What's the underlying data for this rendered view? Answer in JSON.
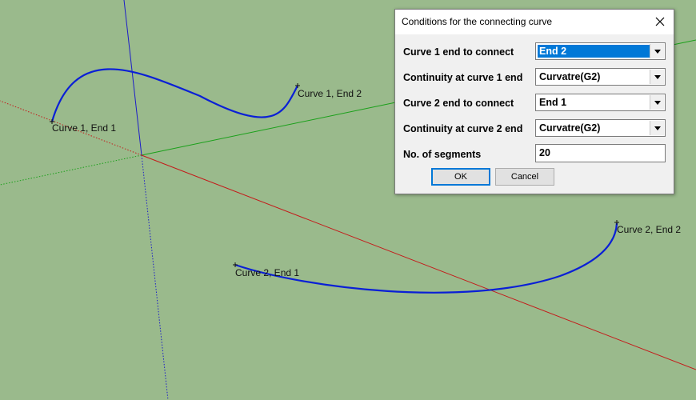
{
  "viewport": {
    "labels": {
      "c1e1": "Curve 1, End 1",
      "c1e2": "Curve 1, End 2",
      "c2e1": "Curve 2, End 1",
      "c2e2": "Curve 2, End 2"
    },
    "colors": {
      "background": "#9aba8c",
      "curve": "#0a1fd6",
      "x_axis": "#c41a1a",
      "y_axis": "#1aa01a",
      "z_axis": "#1c1cc8"
    }
  },
  "dialog": {
    "title": "Conditions for the connecting curve",
    "close_icon": "close-icon",
    "rows": [
      {
        "label": "Curve 1 end to connect",
        "value": "End 2"
      },
      {
        "label": "Continuity at curve 1 end",
        "value": "Curvatre(G2)"
      },
      {
        "label": "Curve 2 end to connect",
        "value": "End 1"
      },
      {
        "label": "Continuity at curve 2 end",
        "value": "Curvatre(G2)"
      }
    ],
    "segments": {
      "label": "No. of segments",
      "value": "20"
    },
    "ok_label": "OK",
    "cancel_label": "Cancel"
  }
}
